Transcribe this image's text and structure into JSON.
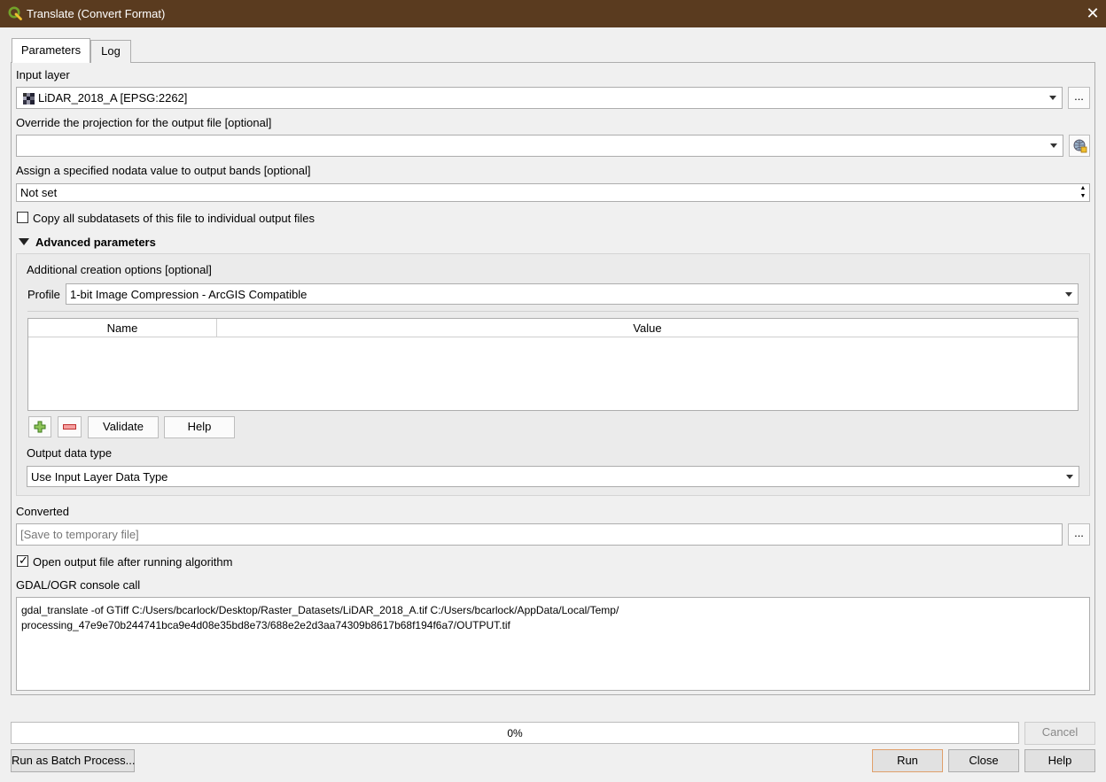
{
  "window": {
    "title": "Translate (Convert Format)",
    "close_glyph": "✕",
    "icon": "qgis-logo-icon"
  },
  "tabs": [
    {
      "label": "Parameters",
      "active": true
    },
    {
      "label": "Log",
      "active": false
    }
  ],
  "input_layer": {
    "label": "Input layer",
    "value": "LiDAR_2018_A [EPSG:2262]",
    "browse": "..."
  },
  "projection": {
    "label": "Override the projection for the output file [optional]",
    "value": ""
  },
  "nodata": {
    "label": "Assign a specified nodata value to output bands [optional]",
    "value": "Not set"
  },
  "subdatasets": {
    "label": "Copy all subdatasets of this file to individual output files",
    "checked": false
  },
  "advanced": {
    "header": "Advanced parameters",
    "creation_label": "Additional creation options [optional]",
    "profile_label": "Profile",
    "profile_value": "1-bit Image Compression - ArcGIS Compatible",
    "columns": [
      "Name",
      "Value"
    ],
    "validate": "Validate",
    "help": "Help",
    "output_type_label": "Output data type",
    "output_type_value": "Use Input Layer Data Type"
  },
  "converted": {
    "label": "Converted",
    "placeholder": "[Save to temporary file]",
    "browse": "..."
  },
  "open_output": {
    "label": "Open output file after running algorithm",
    "checked": true
  },
  "console": {
    "label": "GDAL/OGR console call",
    "line1": "gdal_translate -of GTiff C:/Users/bcarlock/Desktop/Raster_Datasets/LiDAR_2018_A.tif C:/Users/bcarlock/AppData/Local/Temp/",
    "line2": "processing_47e9e70b244741bca9e4d08e35bd8e73/688e2e2d3aa74309b8617b68f194f6a7/OUTPUT.tif"
  },
  "progress": {
    "value": 0,
    "text": "0%"
  },
  "buttons": {
    "cancel": "Cancel",
    "batch": "Run as Batch Process...",
    "run": "Run",
    "close": "Close",
    "help": "Help"
  },
  "colors": {
    "titlebar": "#5a3b1f",
    "run_border": "#e0a06b",
    "qgis_green": "#73a32a",
    "qgis_yellow": "#f0c030"
  }
}
